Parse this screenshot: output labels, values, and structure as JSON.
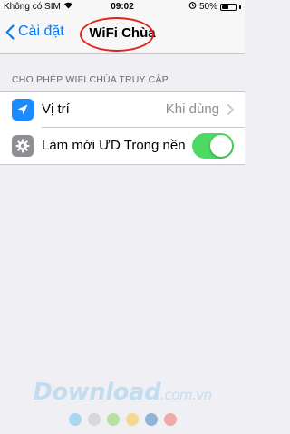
{
  "status_bar": {
    "carrier": "Không có SIM",
    "time": "09:02",
    "battery_percent": "50%",
    "battery_level": 0.5
  },
  "nav": {
    "back_label": "Cài đặt",
    "title": "WiFi Chùa",
    "highlight_color": "#e2231a"
  },
  "section": {
    "header": "CHO PHÉP WIFI CHÙA TRUY CẬP",
    "rows": [
      {
        "label": "Vị trí",
        "value": "Khi dùng",
        "icon": "location-arrow-icon",
        "icon_color": "#1a8cff"
      },
      {
        "label": "Làm mới ƯD Trong nền",
        "icon": "gear-icon",
        "icon_color": "#8e8e93",
        "toggle_on": true,
        "toggle_color": "#4cd964"
      }
    ]
  },
  "watermark": {
    "text": "Download",
    "suffix": ".com.vn",
    "dot_colors": [
      "#a8d8f0",
      "#d8d8d8",
      "#b8e0a0",
      "#f5d890",
      "#8fb4d8",
      "#f0a8a8"
    ]
  }
}
